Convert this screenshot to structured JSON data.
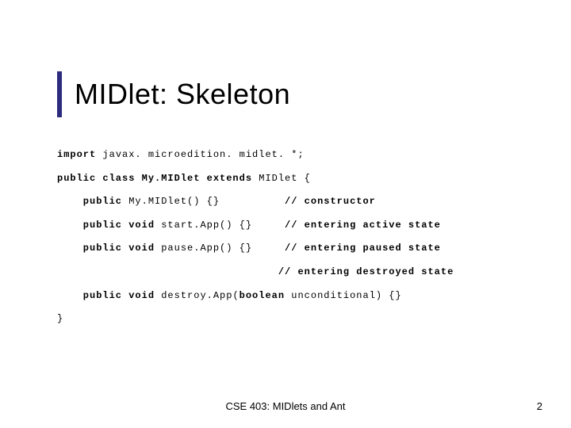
{
  "title": "MIDlet: Skeleton",
  "code": {
    "l1a": "import",
    "l1b": " javax. microedition. midlet. *;",
    "l2a": "public class My.MIDlet extends",
    "l2b": " MIDlet {",
    "l3a": "    public",
    "l3b": " My.MIDlet() {}        ",
    "l3c": "  // constructor",
    "l4a": "    public void",
    "l4b": " start.App() {}   ",
    "l4c": "  // entering active state",
    "l5a": "    public void",
    "l5b": " pause.App() {}   ",
    "l5c": "  // entering paused state",
    "l6": "                                  // entering destroyed state",
    "l7a": "    public void",
    "l7b": " destroy.App(",
    "l7c": "boolean",
    "l7d": " unconditional) {}",
    "l8": "}"
  },
  "footer": {
    "center": "CSE 403: MIDlets and Ant",
    "page": "2"
  }
}
